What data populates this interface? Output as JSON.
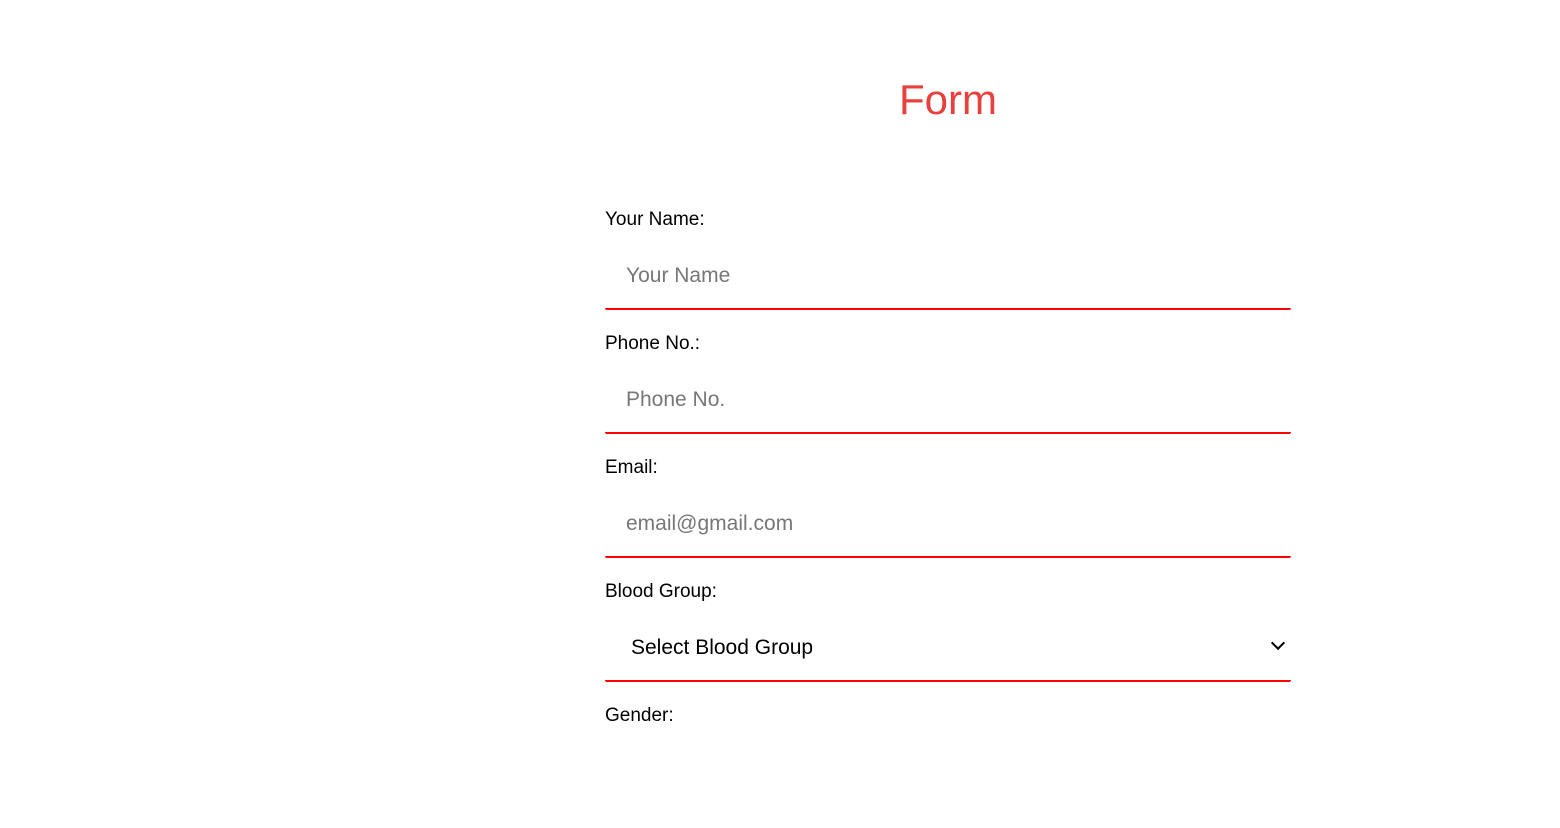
{
  "title": "Form",
  "fields": [
    {
      "label": "Your Name:",
      "placeholder": "Your Name",
      "value": ""
    },
    {
      "label": "Phone No.:",
      "placeholder": "Phone No.",
      "value": ""
    },
    {
      "label": "Email:",
      "placeholder": "email@gmail.com",
      "value": ""
    },
    {
      "label": "Blood Group:",
      "selected": "Select Blood Group"
    },
    {
      "label": "Gender:"
    }
  ],
  "colors": {
    "accent": "#e8403c",
    "underline": "#ff0000"
  }
}
